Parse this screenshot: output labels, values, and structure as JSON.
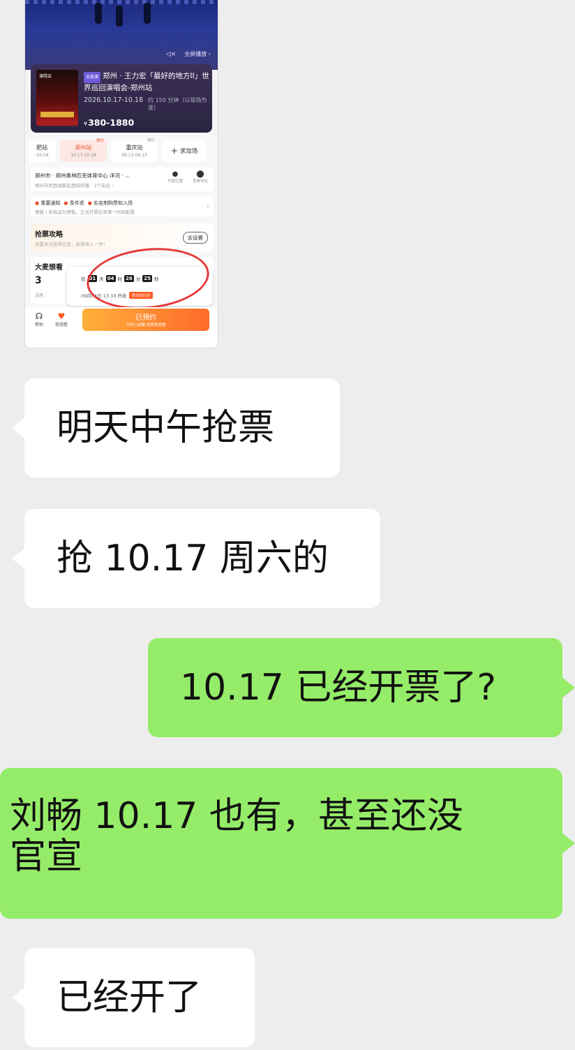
{
  "screenshot": {
    "stage": {
      "mute_icon": "mute-icon",
      "fullscreen_label": "全屏播放 ›"
    },
    "event": {
      "tag": "全部演",
      "poster_tag": "演唱会",
      "title": "郑州 · 王力宏「最好的地方II」世界巡回演唱会-郑州站",
      "date": "2026.10.17-10.18",
      "duration": "约 150 分钟（以现场为准）",
      "price_currency": "¥",
      "price": "380-1880"
    },
    "stations": [
      {
        "name": "肥站",
        "date": "-10.04",
        "badge": ""
      },
      {
        "name": "郑州站",
        "date": "10.17-10.18",
        "badge": "预约"
      },
      {
        "name": "重庆站",
        "date": "09.12-09.13",
        "badge": "预约"
      }
    ],
    "add_show_label": "求加场",
    "venue": {
      "name": "郑州市 · 郑州奥林匹克体育中心 洋河 · ...",
      "address": "郑州市常西湖新区西四环路 · 2个演出 ›",
      "icon1_label": "先囤位置",
      "icon2_label": "查看地址"
    },
    "notice": {
      "items": [
        "重要通知",
        "条件退",
        "实名制购票和入场"
      ],
      "sub": "预售 | 本商品为预售，正式开票后将第一时间配票"
    },
    "strategy": {
      "title": "抢票攻略",
      "sub": "设置本次抢票信息，抢票快人一步！",
      "button": "去设置"
    },
    "partial": {
      "title": "大麦想看",
      "num": "3",
      "small": "这座..."
    },
    "countdown": {
      "prefix": "仅",
      "days": "01",
      "days_unit": "天",
      "hours": "04",
      "hours_unit": "时",
      "minutes": "26",
      "minutes_unit": "分",
      "seconds": "25",
      "seconds_unit": "秒",
      "open_time": "09月04日 13:33 开抢",
      "remind": "添加到日历"
    },
    "bottom": {
      "help_label": "帮助",
      "want_label": "我想看",
      "reserved_label": "已预约",
      "reserved_sub": "开抢已提醒 抢票更便捷"
    }
  },
  "chat": [
    {
      "side": "in",
      "text": "明天中午抢票"
    },
    {
      "side": "in",
      "text": "抢 10.17 周六的"
    },
    {
      "side": "out",
      "text": "10.17 已经开票了?"
    },
    {
      "side": "out",
      "text": "刘畅 10.17 也有，甚至还没",
      "text2": "官宣"
    },
    {
      "side": "in",
      "text": "已经开了"
    }
  ]
}
